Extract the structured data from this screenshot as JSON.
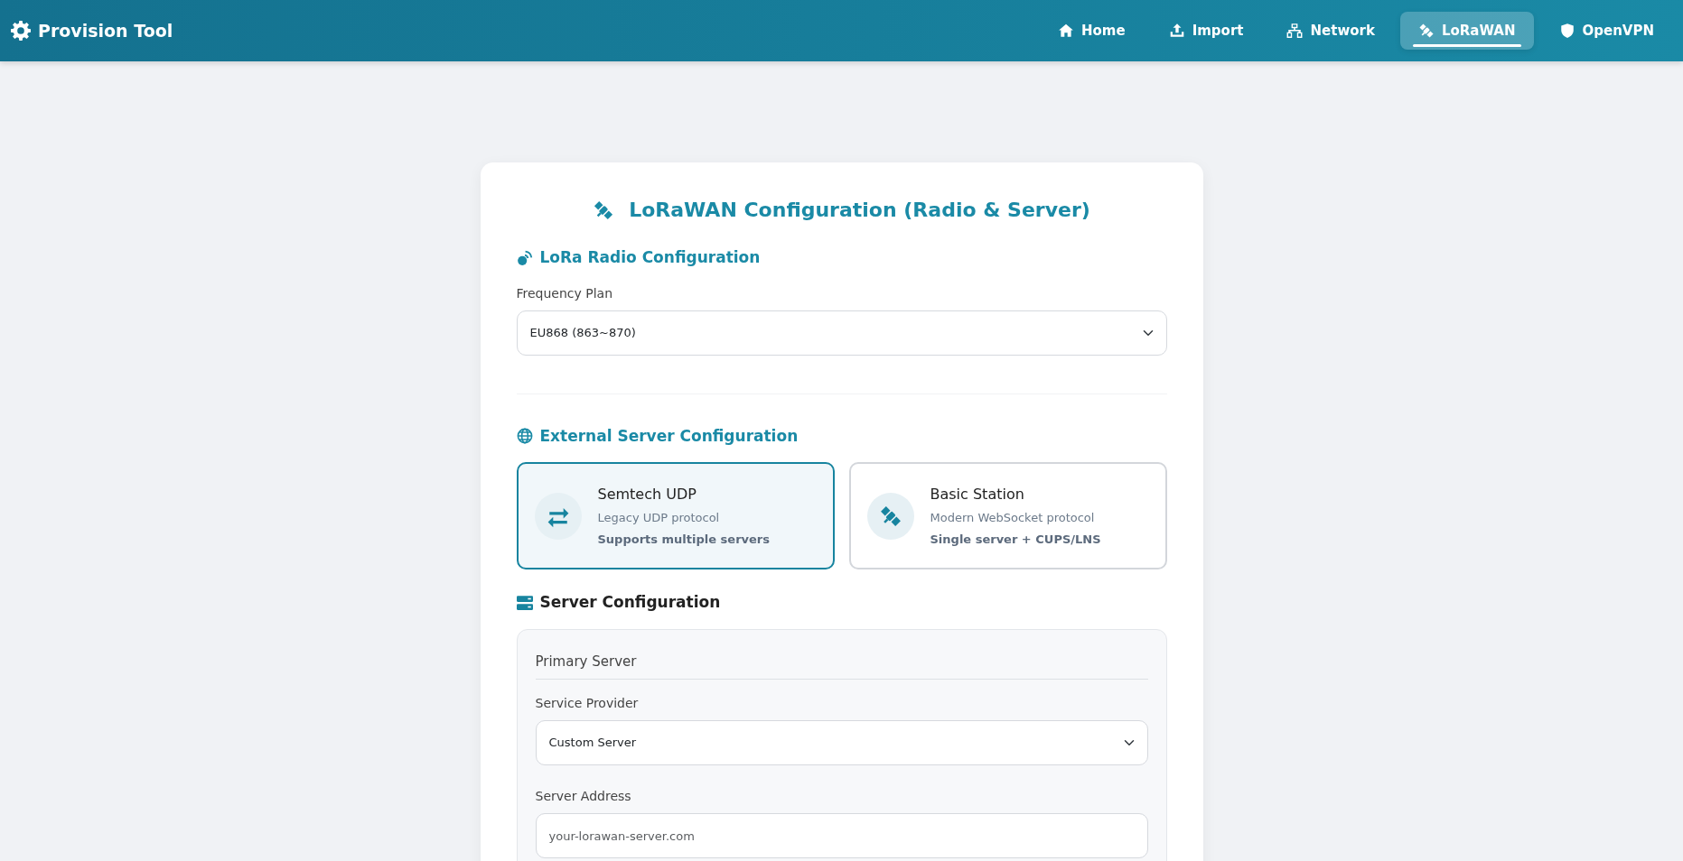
{
  "navbar": {
    "brand": "Provision Tool",
    "items": [
      {
        "label": "Home",
        "kind": "home",
        "selected": false
      },
      {
        "label": "Import",
        "kind": "upload",
        "selected": false
      },
      {
        "label": "Network",
        "kind": "network",
        "selected": false
      },
      {
        "label": "LoRaWAN",
        "kind": "satellite",
        "selected": true
      },
      {
        "label": "OpenVPN",
        "kind": "shield",
        "selected": false
      }
    ]
  },
  "card": {
    "title": "LoRaWAN Configuration (Radio & Server)",
    "radio_section": {
      "heading": "LoRa Radio Configuration",
      "frequency_plan": {
        "label": "Frequency Plan",
        "value": "EU868 (863~870)"
      }
    },
    "server_section": {
      "heading": "External Server Configuration",
      "protocols": [
        {
          "name": "Semtech UDP",
          "description": "Legacy UDP protocol",
          "note": "Supports multiple servers",
          "kind": "arrows",
          "selected": true
        },
        {
          "name": "Basic Station",
          "description": "Modern WebSocket protocol",
          "note": "Single server + CUPS/LNS",
          "kind": "satellite",
          "selected": false
        }
      ]
    },
    "server_config": {
      "heading": "Server Configuration",
      "panel_title": "Primary Server",
      "service_provider": {
        "label": "Service Provider",
        "value": "Custom Server"
      },
      "server_address": {
        "label": "Server Address",
        "placeholder": "your-lorawan-server.com"
      }
    }
  }
}
